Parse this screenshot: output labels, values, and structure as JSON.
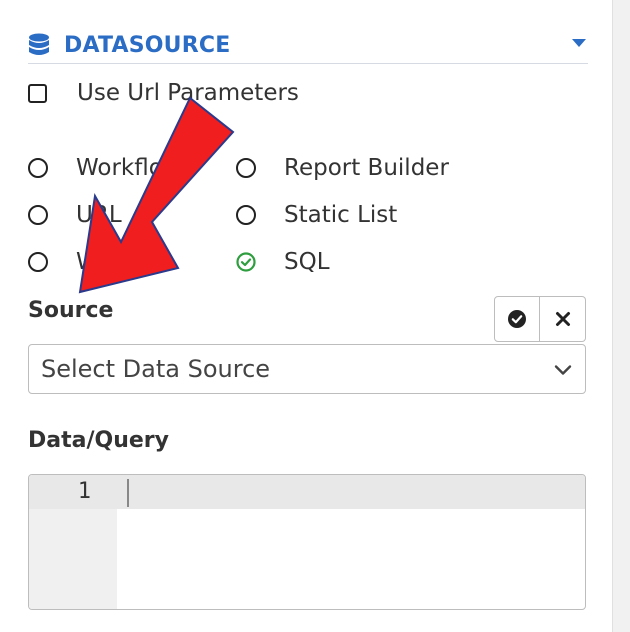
{
  "header": {
    "title": "DATASOURCE",
    "icon": "database-icon",
    "color": "#2b6cc4"
  },
  "url_params": {
    "label": "Use Url Parameters",
    "checked": false
  },
  "radios": [
    {
      "label": "Workflow",
      "selected": false
    },
    {
      "label": "Report Builder",
      "selected": false
    },
    {
      "label": "URL",
      "selected": false
    },
    {
      "label": "Static List",
      "selected": false
    },
    {
      "label": "Widget",
      "selected": false
    },
    {
      "label": "SQL",
      "selected": true
    }
  ],
  "source": {
    "label": "Source",
    "select_value": "Select Data Source"
  },
  "query": {
    "label": "Data/Query",
    "line_number": "1"
  },
  "colors": {
    "accent": "#2b6cc4",
    "selected_radio": "#2e9e3e",
    "annotation_arrow": "#f01e1e"
  }
}
